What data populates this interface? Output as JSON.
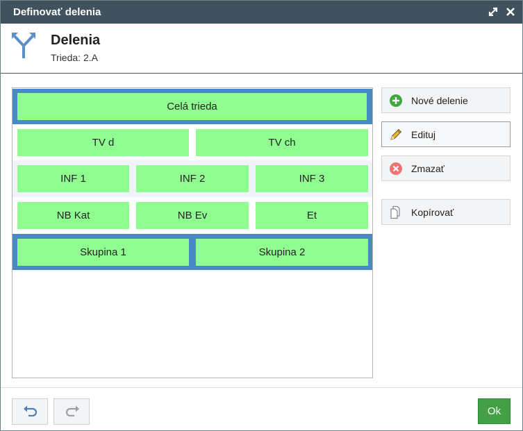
{
  "window": {
    "title": "Definovať delenia"
  },
  "header": {
    "title": "Delenia",
    "subtitle": "Trieda: 2.A"
  },
  "divisions": {
    "row1": [
      "Celá trieda"
    ],
    "row2": [
      "TV d",
      "TV ch"
    ],
    "row3": [
      "INF 1",
      "INF 2",
      "INF 3"
    ],
    "row4": [
      "NB Kat",
      "NB Ev",
      "Et"
    ],
    "row5": [
      "Skupina 1",
      "Skupina 2"
    ]
  },
  "sidebar": {
    "new_label": "Nové delenie",
    "edit_label": "Edituj",
    "delete_label": "Zmazať",
    "copy_label": "Kopírovať"
  },
  "footer": {
    "ok_label": "Ok"
  },
  "colors": {
    "titlebar": "#3f525d",
    "cell": "#8ffd8f",
    "selected": "#4a8ac4",
    "ok": "#43a047"
  }
}
